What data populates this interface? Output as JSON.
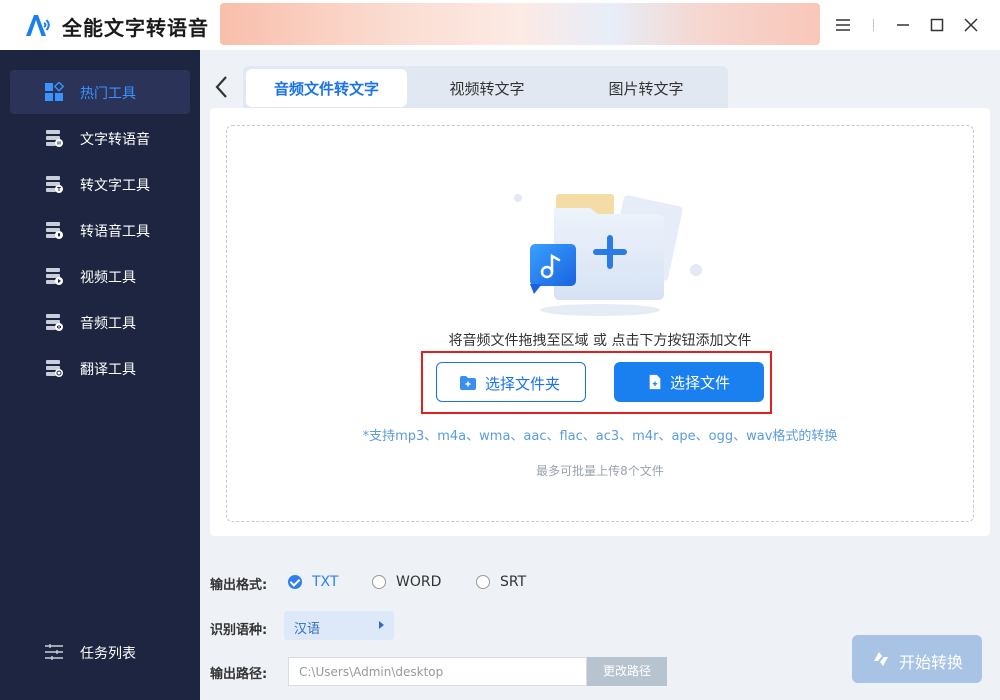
{
  "app": {
    "title": "全能文字转语音"
  },
  "window_controls": {
    "menu": "menu-icon",
    "minimize": "minimize-icon",
    "maximize": "maximize-icon",
    "close": "close-icon"
  },
  "sidebar": {
    "items": [
      {
        "label": "热门工具",
        "icon": "grid-icon",
        "active": true
      },
      {
        "label": "文字转语音",
        "icon": "text-to-speech-icon"
      },
      {
        "label": "转文字工具",
        "icon": "to-text-tool-icon"
      },
      {
        "label": "转语音工具",
        "icon": "to-speech-tool-icon"
      },
      {
        "label": "视频工具",
        "icon": "video-tool-icon"
      },
      {
        "label": "音频工具",
        "icon": "audio-tool-icon"
      },
      {
        "label": "翻译工具",
        "icon": "translate-tool-icon"
      }
    ],
    "task_list": "任务列表"
  },
  "tabs": [
    {
      "label": "音频文件转文字",
      "active": true
    },
    {
      "label": "视频转文字"
    },
    {
      "label": "图片转文字"
    }
  ],
  "dropzone": {
    "hint": "将音频文件拖拽至区域 或 点击下方按钮添加文件",
    "select_folder": "选择文件夹",
    "select_file": "选择文件",
    "formats": "*支持mp3、m4a、wma、aac、flac、ac3、m4r、ape、ogg、wav格式的转换",
    "limit": "最多可批量上传8个文件"
  },
  "settings": {
    "output_format_label": "输出格式:",
    "formats": [
      {
        "label": "TXT",
        "checked": true
      },
      {
        "label": "WORD"
      },
      {
        "label": "SRT"
      }
    ],
    "language_label": "识别语种:",
    "language_value": "汉语",
    "path_label": "输出路径:",
    "path_value": "C:\\Users\\Admin\\desktop",
    "change_path": "更改路径",
    "start": "开始转换"
  },
  "colors": {
    "accent": "#1a7fef",
    "sidebar_bg": "#1d2541",
    "highlight": "#e0211f",
    "start_btn": "#a9c3e4"
  }
}
